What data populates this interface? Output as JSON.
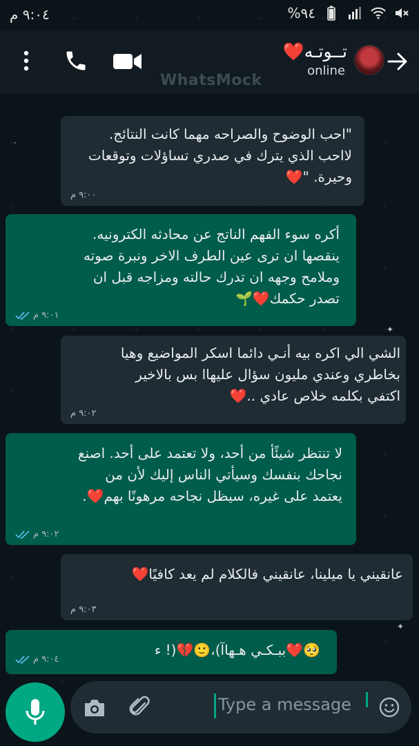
{
  "status_bar": {
    "time": "٩:٠٤ م",
    "battery": "%٩٤"
  },
  "header": {
    "contact_name": "تــوتـه❤️",
    "status": "online",
    "watermark": "WhatsMock"
  },
  "messages": [
    {
      "direction": "incoming",
      "text": "\"احب الوضوح والصراحه مهما كانت النتائج.\nلااحب الذي يترك في صدري تساؤلات وتوقعات\nوحيرة. \"❤️",
      "time": "٩:٠٠ م"
    },
    {
      "direction": "outgoing",
      "text": "أكره سوء الفهم الناتج عن محادثه الكترونيه.\nينقصها ان ترى عين الطرف الاخر ونبرة صوته\nوملامح وجهه ان تدرك حالته ومزاجه قبل ان\nتصدر حكمك❤️🌱",
      "time": "٩:٠١ م"
    },
    {
      "direction": "incoming",
      "text": "الشي الي اكره بيه  أنـي  دائما اسكر المواضيع وهيا\nبخاطري وعندي مليون سؤال عليهاا بس بالاخير\nاكتفي بكلمه خلاص عادي ..❤️",
      "time": "٩:٠٢ م"
    },
    {
      "direction": "outgoing",
      "text": "لا تنتظر شيئًأ من أحد، ولا تعتمد على أحد. اصنع\nنجاحك بنفسك وسيأتي الناس إليك لأن من\nيعتمد على غيره، سيظل نجاحه مرهونًا بهم❤️.",
      "time": "٩:٠٢ م"
    },
    {
      "direction": "incoming",
      "text": "عانقيني يا ميلينا، عانقيني فالكلام لم يعد كافيًا❤️",
      "time": "٩:٠٣ م"
    },
    {
      "direction": "outgoing",
      "text": "🥺❤️ببـكـي هـهاآ)،🙂💔(! ء",
      "time": "٩:٠٤ م"
    }
  ],
  "composer": {
    "placeholder": "Type a message"
  },
  "colors": {
    "incoming_bubble": "#1f2c33",
    "outgoing_bubble": "#005c4b",
    "accent": "#00a884",
    "read_ticks": "#53bdeb"
  },
  "icons": {
    "status_bar": [
      "mute-icon",
      "wifi-icon",
      "signal-icon",
      "battery-icon"
    ],
    "header": [
      "back-arrow-icon",
      "avatar",
      "video-call-icon",
      "voice-call-icon",
      "menu-icon"
    ],
    "composer": [
      "mic-icon",
      "camera-icon",
      "attach-icon",
      "emoji-icon"
    ]
  }
}
